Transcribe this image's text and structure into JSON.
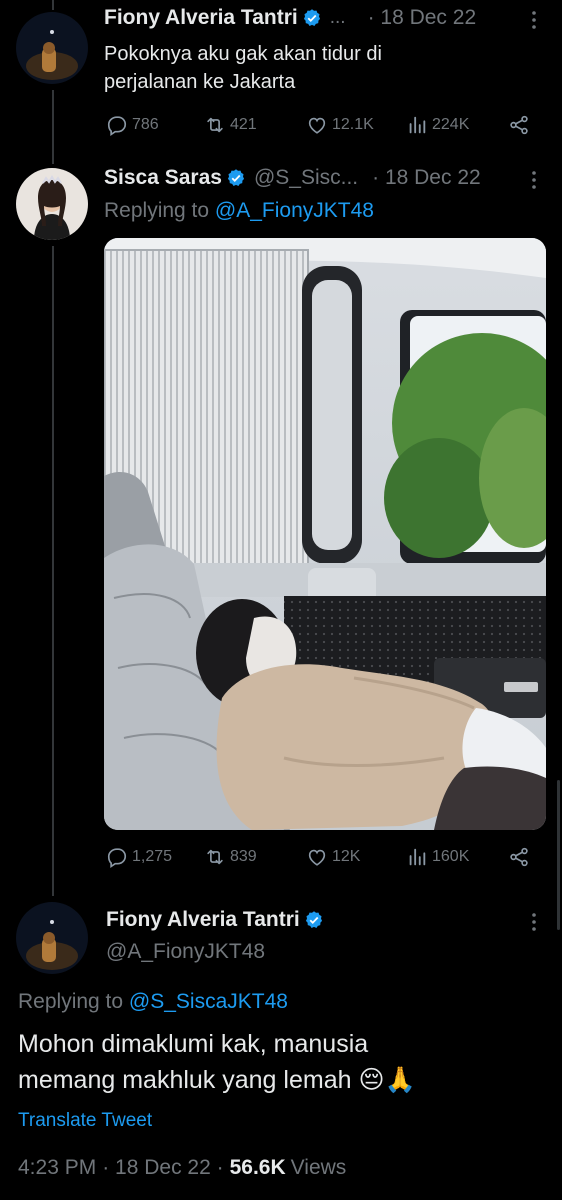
{
  "tweet1": {
    "name": "Fiony Alveria Tantri",
    "handle_truncated": "...",
    "date": "· 18 Dec 22",
    "text_line1": "Pokoknya aku gak akan tidur di",
    "text_line2": "perjalanan ke Jakarta",
    "replies": "786",
    "retweets": "421",
    "likes": "12.1K",
    "views": "224K"
  },
  "tweet2": {
    "name": "Sisca Saras",
    "handle": "@S_Sisc...",
    "date": "· 18 Dec 22",
    "replying_prefix": "Replying to ",
    "replying_handle": "@A_FionyJKT48",
    "replies": "1,275",
    "retweets": "839",
    "likes": "12K",
    "views": "160K"
  },
  "tweet3": {
    "name": "Fiony Alveria Tantri",
    "handle": "@A_FionyJKT48",
    "replying_prefix": "Replying to ",
    "replying_handle": "@S_SiscaJKT48",
    "text_line1": "Mohon dimaklumi kak, manusia",
    "text_line2": "memang makhluk yang lemah",
    "emoji": "😔🙏",
    "translate": "Translate Tweet",
    "time": "4:23 PM",
    "date": "· 18 Dec 22 ·",
    "views_count": "56.6K",
    "views_label": "Views"
  },
  "icons": {
    "reply": "reply-icon",
    "retweet": "retweet-icon",
    "like": "heart-icon",
    "views": "views-icon",
    "share": "share-icon",
    "more": "more-vertical-icon",
    "verified": "verified-badge-icon"
  },
  "colors": {
    "background": "#000000",
    "text": "#e7e9ea",
    "muted": "#71767b",
    "accent": "#1d9bf0"
  }
}
